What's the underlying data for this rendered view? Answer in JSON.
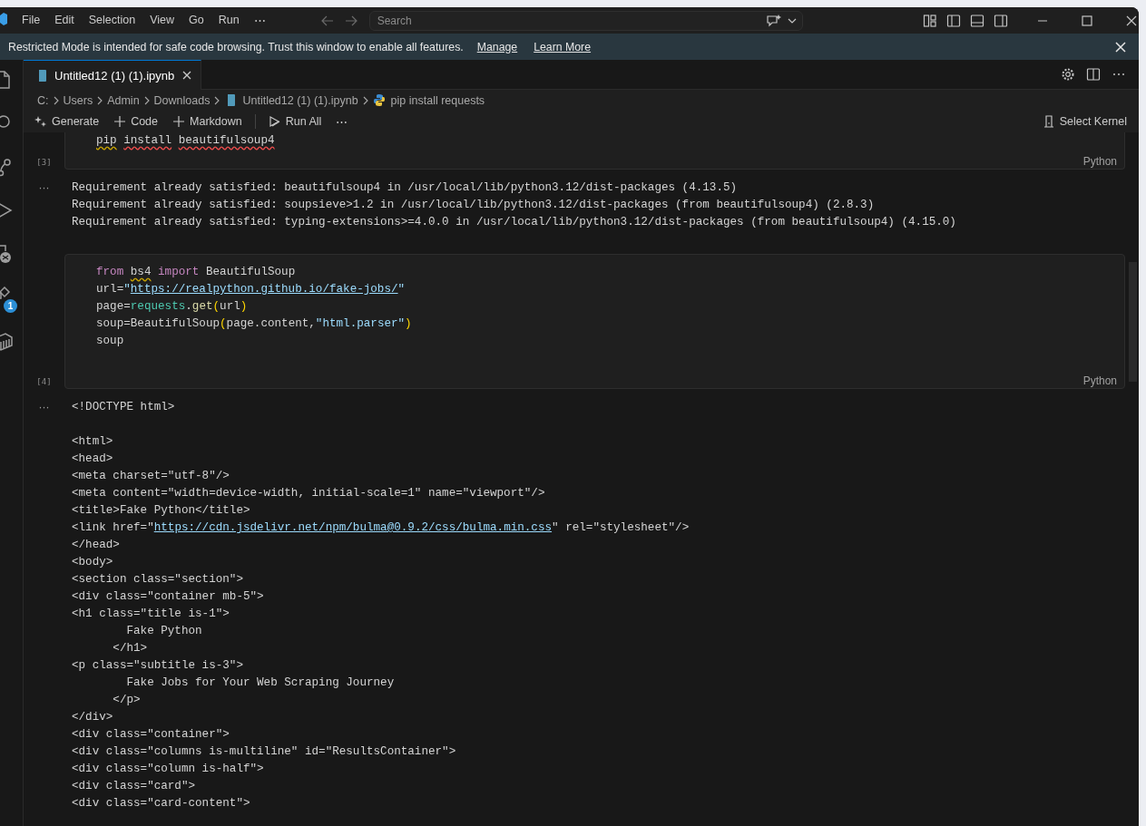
{
  "title_bar": {
    "menu": [
      "File",
      "Edit",
      "Selection",
      "View",
      "Go",
      "Run",
      "⋯"
    ],
    "search": {
      "placeholder": "Search"
    }
  },
  "banner": {
    "message": "Restricted Mode is intended for safe code browsing. Trust this window to enable all features.",
    "links": [
      "Manage",
      "Learn More"
    ]
  },
  "activity_bar": {
    "extensions_badge": "1"
  },
  "tabs": [
    {
      "label": "Untitled12 (1) (1).ipynb",
      "selected": true
    }
  ],
  "breadcrumb": [
    {
      "label": "C:",
      "kind": "folder"
    },
    {
      "label": "Users",
      "kind": "folder"
    },
    {
      "label": "Admin",
      "kind": "folder"
    },
    {
      "label": "Downloads",
      "kind": "folder"
    },
    {
      "label": "Untitled12 (1) (1).ipynb",
      "kind": "notebook"
    },
    {
      "label": "pip install requests",
      "kind": "python"
    }
  ],
  "toolbar": {
    "items": [
      {
        "label": "Generate",
        "kind": "generate"
      },
      {
        "label": "Code",
        "kind": "add"
      },
      {
        "label": "Markdown",
        "kind": "add"
      },
      {
        "label": "Run All",
        "kind": "run"
      }
    ],
    "more": "⋯",
    "kernel": "Select Kernel"
  },
  "cells": [
    {
      "execution_count": "[3]",
      "language": "Python",
      "code": [
        [
          {
            "text": "pip",
            "kind": "plain",
            "warning": true
          },
          {
            "text": " install",
            "kind": "plain",
            "error": true
          },
          {
            "text": " beautifulsoup4",
            "kind": "plain",
            "error": true
          }
        ]
      ],
      "output_marker": "···",
      "output": [
        "Requirement already satisfied: beautifulsoup4 in /usr/local/lib/python3.12/dist-packages (4.13.5)",
        "Requirement already satisfied: soupsieve>1.2 in /usr/local/lib/python3.12/dist-packages (from beautifulsoup4) (2.8.3)",
        "Requirement already satisfied: typing-extensions>=4.0.0 in /usr/local/lib/python3.12/dist-packages (from beautifulsoup4) (4.15.0)"
      ]
    },
    {
      "execution_count": "[4]",
      "language": "Python",
      "code": [
        [
          {
            "text": "from ",
            "kind": "keyword"
          },
          {
            "text": "bs4",
            "kind": "plain",
            "warning": true
          },
          {
            "text": " import ",
            "kind": "keyword"
          },
          {
            "text": "BeautifulSoup",
            "kind": "plain"
          }
        ],
        [
          {
            "text": "url=",
            "kind": "plain"
          },
          {
            "text": "\"",
            "kind": "string"
          },
          {
            "text": "https://realpython.github.io/fake-jobs/",
            "kind": "link"
          },
          {
            "text": "\"",
            "kind": "string"
          }
        ],
        [
          {
            "text": "page=",
            "kind": "plain"
          },
          {
            "text": "requests",
            "kind": "module"
          },
          {
            "text": ".",
            "kind": "plain"
          },
          {
            "text": "get",
            "kind": "function"
          },
          {
            "text": "(",
            "kind": "paren"
          },
          {
            "text": "url",
            "kind": "plain"
          },
          {
            "text": ")",
            "kind": "paren"
          }
        ],
        [
          {
            "text": "soup=BeautifulSoup",
            "kind": "plain"
          },
          {
            "text": "(",
            "kind": "paren"
          },
          {
            "text": "page.content,",
            "kind": "plain"
          },
          {
            "text": "\"html.parser\"",
            "kind": "string"
          },
          {
            "text": ")",
            "kind": "paren"
          }
        ],
        [
          {
            "text": "soup",
            "kind": "plain"
          }
        ]
      ],
      "output_marker": "···",
      "output": [
        "<!DOCTYPE html>",
        {
          "kind": "blank"
        },
        "<html>",
        "<head>",
        "<meta charset=\"utf-8\"/>",
        "<meta content=\"width=device-width, initial-scale=1\" name=\"viewport\"/>",
        "<title>Fake Python</title>",
        {
          "kind": "segments",
          "segments": [
            {
              "text": "<link href=\"",
              "kind": "plain"
            },
            {
              "text": "https://cdn.jsdelivr.net/npm/bulma@0.9.2/css/bulma.min.css",
              "kind": "link"
            },
            {
              "text": "\" rel=\"stylesheet\"/>",
              "kind": "plain"
            }
          ]
        },
        "</head>",
        "<body>",
        "<section class=\"section\">",
        "<div class=\"container mb-5\">",
        "<h1 class=\"title is-1\">",
        "        Fake Python",
        "      </h1>",
        "<p class=\"subtitle is-3\">",
        "        Fake Jobs for Your Web Scraping Journey",
        "      </p>",
        "</div>",
        "<div class=\"container\">",
        "<div class=\"columns is-multiline\" id=\"ResultsContainer\">",
        "<div class=\"column is-half\">",
        "<div class=\"card\">",
        "<div class=\"card-content\">"
      ]
    }
  ]
}
